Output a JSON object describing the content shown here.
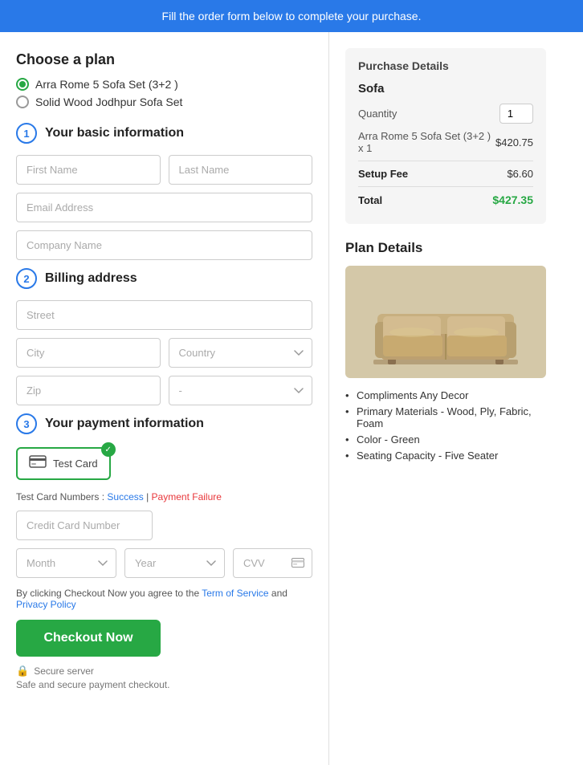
{
  "banner": {
    "text": "Fill the order form below to complete your purchase."
  },
  "left": {
    "choose_plan": {
      "title": "Choose a plan",
      "options": [
        {
          "label": "Arra Rome 5 Sofa Set (3+2 )",
          "selected": true
        },
        {
          "label": "Solid Wood Jodhpur Sofa Set",
          "selected": false
        }
      ]
    },
    "basic_info": {
      "step": "1",
      "title": "Your basic information",
      "first_name_placeholder": "First Name",
      "last_name_placeholder": "Last Name",
      "email_placeholder": "Email Address",
      "company_placeholder": "Company Name"
    },
    "billing": {
      "step": "2",
      "title": "Billing address",
      "street_placeholder": "Street",
      "city_placeholder": "City",
      "country_placeholder": "Country",
      "zip_placeholder": "Zip",
      "state_placeholder": "-"
    },
    "payment": {
      "step": "3",
      "title": "Your payment information",
      "card_label": "Test Card",
      "test_card_label": "Test Card Numbers :",
      "success_link": "Success",
      "failure_link": "Payment Failure",
      "cc_placeholder": "Credit Card Number",
      "month_placeholder": "Month",
      "year_placeholder": "Year",
      "cvv_placeholder": "CVV"
    },
    "terms": {
      "text_before": "By clicking Checkout Now you agree to the ",
      "tos_label": "Term of Service",
      "text_between": " and ",
      "privacy_label": "Privacy Policy"
    },
    "checkout_btn": "Checkout Now",
    "secure": {
      "label": "Secure server",
      "sublabel": "Safe and secure payment checkout."
    }
  },
  "right": {
    "purchase": {
      "title": "Purchase Details",
      "item_name": "Sofa",
      "quantity_label": "Quantity",
      "quantity_value": "1",
      "item_desc": "Arra Rome 5 Sofa Set (3+2 ) x 1",
      "item_price": "$420.75",
      "setup_fee_label": "Setup Fee",
      "setup_fee": "$6.60",
      "total_label": "Total",
      "total": "$427.35"
    },
    "plan_details": {
      "title": "Plan Details",
      "features": [
        "Compliments Any Decor",
        "Primary Materials - Wood, Ply, Fabric, Foam",
        "Color - Green",
        "Seating Capacity - Five Seater"
      ]
    }
  }
}
